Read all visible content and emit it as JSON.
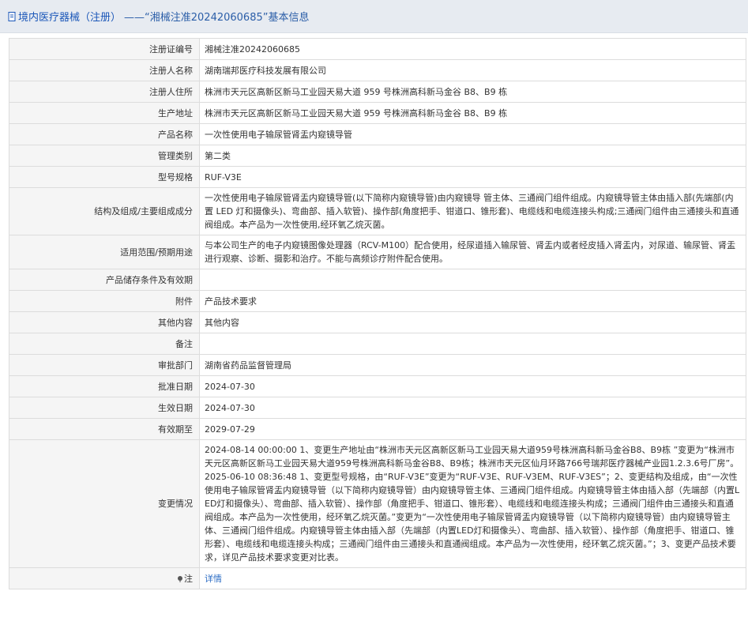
{
  "header": {
    "crumb": "境内医疗器械（注册）",
    "title": "——“湘械注准20242060685”基本信息"
  },
  "rows": [
    {
      "label": "注册证编号",
      "value": "湘械注准20242060685"
    },
    {
      "label": "注册人名称",
      "value": "湖南瑞邦医疗科技发展有限公司"
    },
    {
      "label": "注册人住所",
      "value": "株洲市天元区高新区新马工业园天易大道 959 号株洲高科新马金谷 B8、B9 栋"
    },
    {
      "label": "生产地址",
      "value": "株洲市天元区高新区新马工业园天易大道 959 号株洲高科新马金谷 B8、B9 栋"
    },
    {
      "label": "产品名称",
      "value": "一次性使用电子输尿管肾盂内窥镜导管"
    },
    {
      "label": "管理类别",
      "value": "第二类"
    },
    {
      "label": "型号规格",
      "value": "RUF-V3E"
    },
    {
      "label": "结构及组成/主要组成成分",
      "value": "一次性使用电子输尿管肾盂内窥镜导管(以下简称内窥镜导管)由内窥镜导 管主体、三通阀门组件组成。内窥镜导管主体由插入部(先端部(内置 LED 灯和摄像头)、弯曲部、插入软管)、操作部(角度把手、钳道口、锥形套)、电缆线和电缆连接头构成;三通阀门组件由三通接头和直通阀组成。本产品为一次性使用,经环氧乙烷灭菌。"
    },
    {
      "label": "适用范围/预期用途",
      "value": "与本公司生产的电子内窥镜图像处理器（RCV-M100）配合使用，经尿道插入输尿管、肾盂内或者经皮插入肾盂内，对尿道、输尿管、肾盂进行观察、诊断、摄影和治疗。不能与高频诊疗附件配合使用。"
    },
    {
      "label": "产品储存条件及有效期",
      "value": ""
    },
    {
      "label": "附件",
      "value": "产品技术要求"
    },
    {
      "label": "其他内容",
      "value": "其他内容"
    },
    {
      "label": "备注",
      "value": ""
    },
    {
      "label": "审批部门",
      "value": "湖南省药品监督管理局"
    },
    {
      "label": "批准日期",
      "value": "2024-07-30"
    },
    {
      "label": "生效日期",
      "value": "2024-07-30"
    },
    {
      "label": "有效期至",
      "value": "2029-07-29"
    }
  ],
  "changes": {
    "label": "变更情况",
    "text": "2024-08-14 00:00:00 1、变更生产地址由“株洲市天元区高新区新马工业园天易大道959号株洲高科新马金谷B8、B9栋 ”变更为“株洲市天元区高新区新马工业园天易大道959号株洲高科新马金谷B8、B9栋；株洲市天元区仙月环路766号瑞邦医疗器械产业园1.2.3.6号厂房”。\n2025-06-10 08:36:48 1、变更型号规格，由“RUF-V3E”变更为“RUF-V3E、RUF-V3EM、RUF-V3ES”；2、变更结构及组成，由“一次性使用电子输尿管肾盂内窥镜导管（以下简称内窥镜导管）由内窥镜导管主体、三通阀门组件组成。内窥镜导管主体由插入部（先端部（内置LED灯和摄像头）、弯曲部、插入软管）、操作部（角度把手、钳道口、锥形套）、电缆线和电缆连接头构成；三通阀门组件由三通接头和直通阀组成。本产品为一次性使用，经环氧乙烷灭菌。”变更为“一次性使用电子输尿管肾盂内窥镜导管（以下简称内窥镜导管）由内窥镜导管主体、三通阀门组件组成。内窥镜导管主体由插入部（先端部（内置LED灯和摄像头）、弯曲部、插入软管）、操作部（角度把手、钳道口、锥形套）、电缆线和电缆连接头构成；三通阀门组件由三通接头和直通阀组成。本产品为一次性使用，经环氧乙烷灭菌。”；3、变更产品技术要求，详见产品技术要求变更对比表。"
  },
  "note": {
    "label": "注",
    "link": "详情"
  },
  "colors": {
    "header_bg": "#e7ebf1",
    "label_bg": "#f5f5f5",
    "link": "#2b6cc4"
  }
}
